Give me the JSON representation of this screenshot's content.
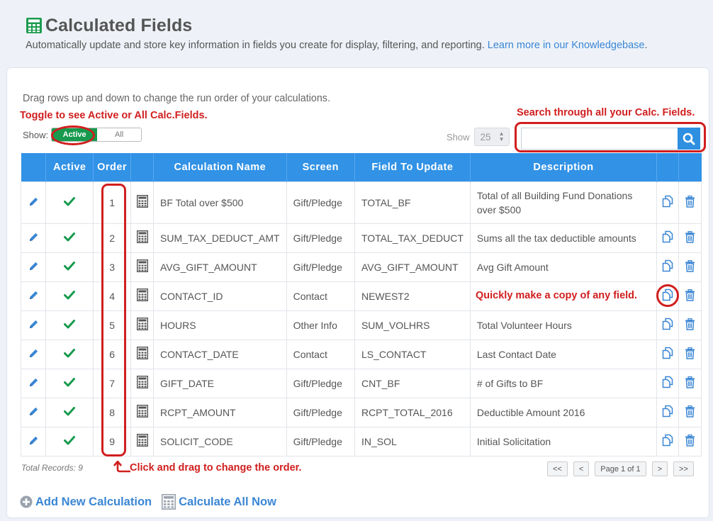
{
  "header": {
    "title": "Calculated Fields",
    "subtitle": "Automatically update and store key information in fields you create for display, filtering, and reporting.",
    "link": "Learn more in our Knowledgebase",
    "subtitle_end": "."
  },
  "hint": "Drag rows up and down to change the run order of your calculations.",
  "annotations": {
    "toggle": "Toggle to see Active or All Calc.Fields.",
    "search": "Search through all your Calc. Fields.",
    "copy": "Quickly make a copy of any field.",
    "drag": "Click and drag to change the order."
  },
  "show": {
    "label": "Show:",
    "active": "Active",
    "all": "All"
  },
  "pagesize": {
    "label": "Show",
    "value": "25"
  },
  "search": {
    "placeholder": ""
  },
  "columns": [
    "Active",
    "Order",
    "Calculation Name",
    "Screen",
    "Field To Update",
    "Description"
  ],
  "rows": [
    {
      "order": "1",
      "name": "BF Total over $500",
      "screen": "Gift/Pledge",
      "field": "TOTAL_BF",
      "desc": "Total of all Building Fund Donations over $500"
    },
    {
      "order": "2",
      "name": "SUM_TAX_DEDUCT_AMT",
      "screen": "Gift/Pledge",
      "field": "TOTAL_TAX_DEDUCT",
      "desc": "Sums all the tax deductible amounts"
    },
    {
      "order": "3",
      "name": "AVG_GIFT_AMOUNT",
      "screen": "Gift/Pledge",
      "field": "AVG_GIFT_AMOUNT",
      "desc": "Avg Gift Amount"
    },
    {
      "order": "4",
      "name": "CONTACT_ID",
      "screen": "Contact",
      "field": "NEWEST2",
      "desc": ""
    },
    {
      "order": "5",
      "name": "HOURS",
      "screen": "Other Info",
      "field": "SUM_VOLHRS",
      "desc": "Total Volunteer Hours"
    },
    {
      "order": "6",
      "name": "CONTACT_DATE",
      "screen": "Contact",
      "field": "LS_CONTACT",
      "desc": "Last Contact Date"
    },
    {
      "order": "7",
      "name": "GIFT_DATE",
      "screen": "Gift/Pledge",
      "field": "CNT_BF",
      "desc": "# of Gifts to BF"
    },
    {
      "order": "8",
      "name": "RCPT_AMOUNT",
      "screen": "Gift/Pledge",
      "field": "RCPT_TOTAL_2016",
      "desc": "Deductible Amount 2016"
    },
    {
      "order": "9",
      "name": "SOLICIT_CODE",
      "screen": "Gift/Pledge",
      "field": "IN_SOL",
      "desc": "Initial Solicitation"
    }
  ],
  "total_records": "Total Records: 9",
  "pager": {
    "first": "<<",
    "prev": "<",
    "page": "Page 1 of 1",
    "next": ">",
    "last": ">>"
  },
  "actions": {
    "add": "Add New Calculation",
    "calc_all": "Calculate All Now"
  },
  "colors": {
    "accent": "#3192e6",
    "active_green": "#179a4e",
    "annotation_red": "#d11e1e",
    "link": "#3a86d4"
  }
}
